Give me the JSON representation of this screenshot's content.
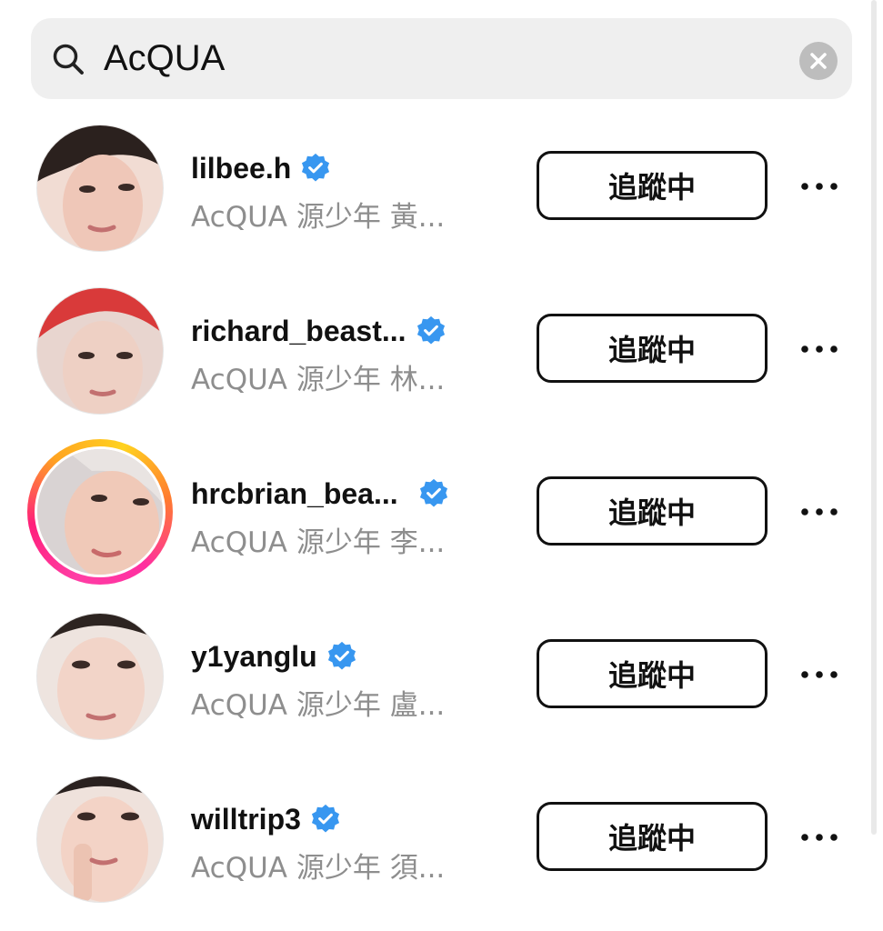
{
  "search": {
    "value": "AcQUA",
    "icon": "search-icon",
    "clear_icon": "clear-icon"
  },
  "accent_colors": {
    "verified": "#3897f0",
    "story_ring_start": "#ff2fa0",
    "story_ring_end": "#ffc21f",
    "subtitle": "#8e8e8e"
  },
  "results": [
    {
      "username": "lilbee.h",
      "verified": true,
      "subtitle": "AcQUA 源少年 黃...",
      "follow_label": "追蹤中",
      "has_story": false,
      "avatar_icon": "profile-photo"
    },
    {
      "username": "richard_beast...",
      "verified": true,
      "subtitle": "AcQUA 源少年 林...",
      "follow_label": "追蹤中",
      "has_story": false,
      "avatar_icon": "profile-photo"
    },
    {
      "username": "hrcbrian_bea...",
      "verified": true,
      "subtitle": "AcQUA 源少年 李...",
      "follow_label": "追蹤中",
      "has_story": true,
      "avatar_icon": "profile-photo"
    },
    {
      "username": "y1yanglu",
      "verified": true,
      "subtitle": "AcQUA 源少年 盧...",
      "follow_label": "追蹤中",
      "has_story": false,
      "avatar_icon": "profile-photo"
    },
    {
      "username": "willtrip3",
      "verified": true,
      "subtitle": "AcQUA 源少年 須...",
      "follow_label": "追蹤中",
      "has_story": false,
      "avatar_icon": "profile-photo"
    }
  ]
}
